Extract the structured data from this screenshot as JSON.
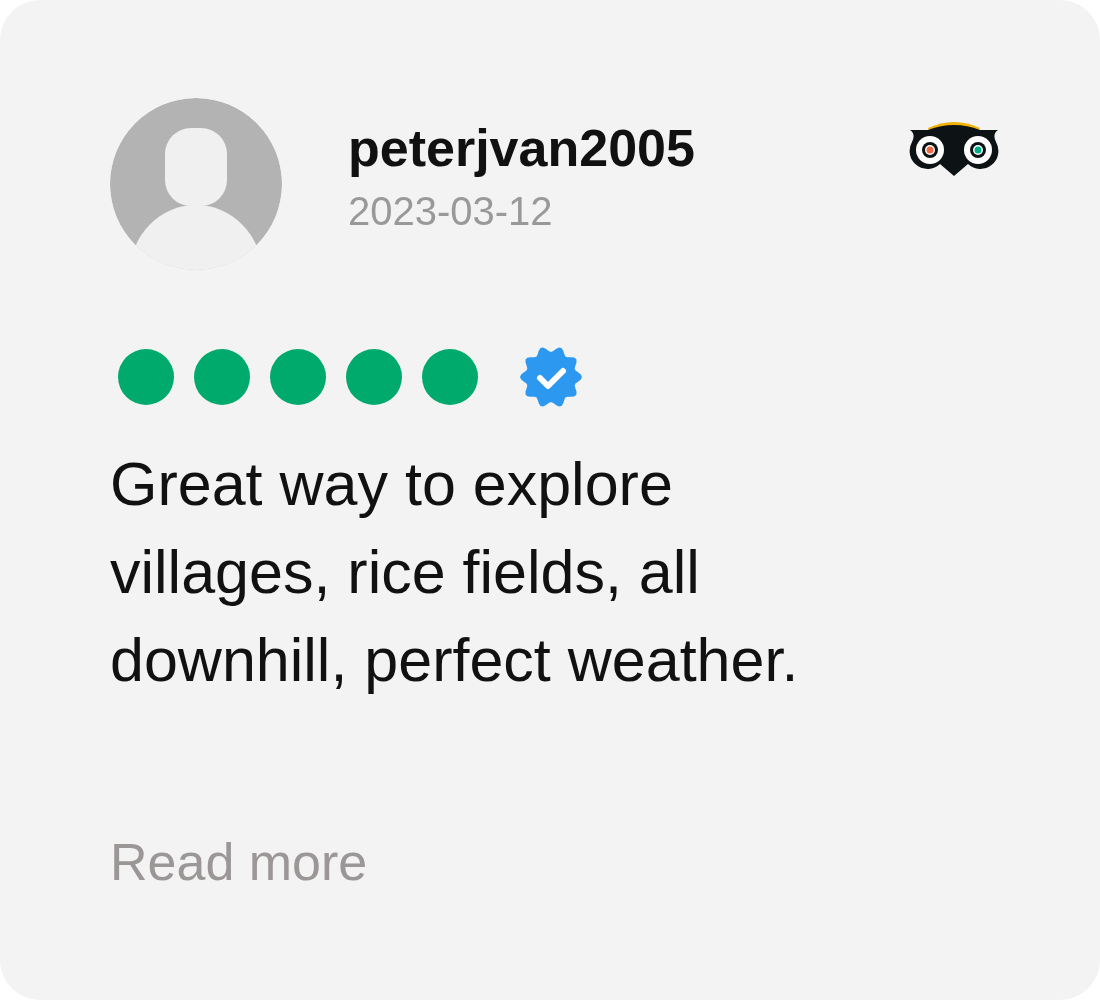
{
  "review": {
    "author": "peterjvan2005",
    "date": "2023-03-12",
    "stars": 5,
    "verified": true,
    "text": "Great way to explore villages, rice fields, all downhill, perfect weather.",
    "read_more": "Read more"
  }
}
